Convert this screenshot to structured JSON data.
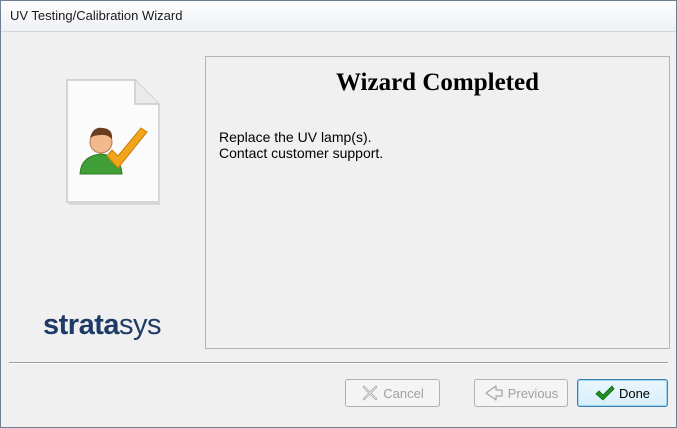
{
  "window": {
    "title": "UV Testing/Calibration Wizard"
  },
  "sidebar": {
    "icon": "document-user-check-icon",
    "logo_bold": "strata",
    "logo_light": "sys"
  },
  "panel": {
    "title": "Wizard Completed",
    "message_lines": [
      "Replace the UV lamp(s).",
      "Contact customer support."
    ]
  },
  "buttons": {
    "cancel": {
      "label": "Cancel",
      "icon": "close-x-icon",
      "enabled": false
    },
    "previous": {
      "label": "Previous",
      "icon": "arrow-left-icon",
      "enabled": false
    },
    "done": {
      "label": "Done",
      "icon": "checkmark-icon",
      "enabled": true
    }
  },
  "colors": {
    "logo": "#1e3a66",
    "done_check": "#1f8f1f",
    "focus_border": "#3c7fb1"
  }
}
